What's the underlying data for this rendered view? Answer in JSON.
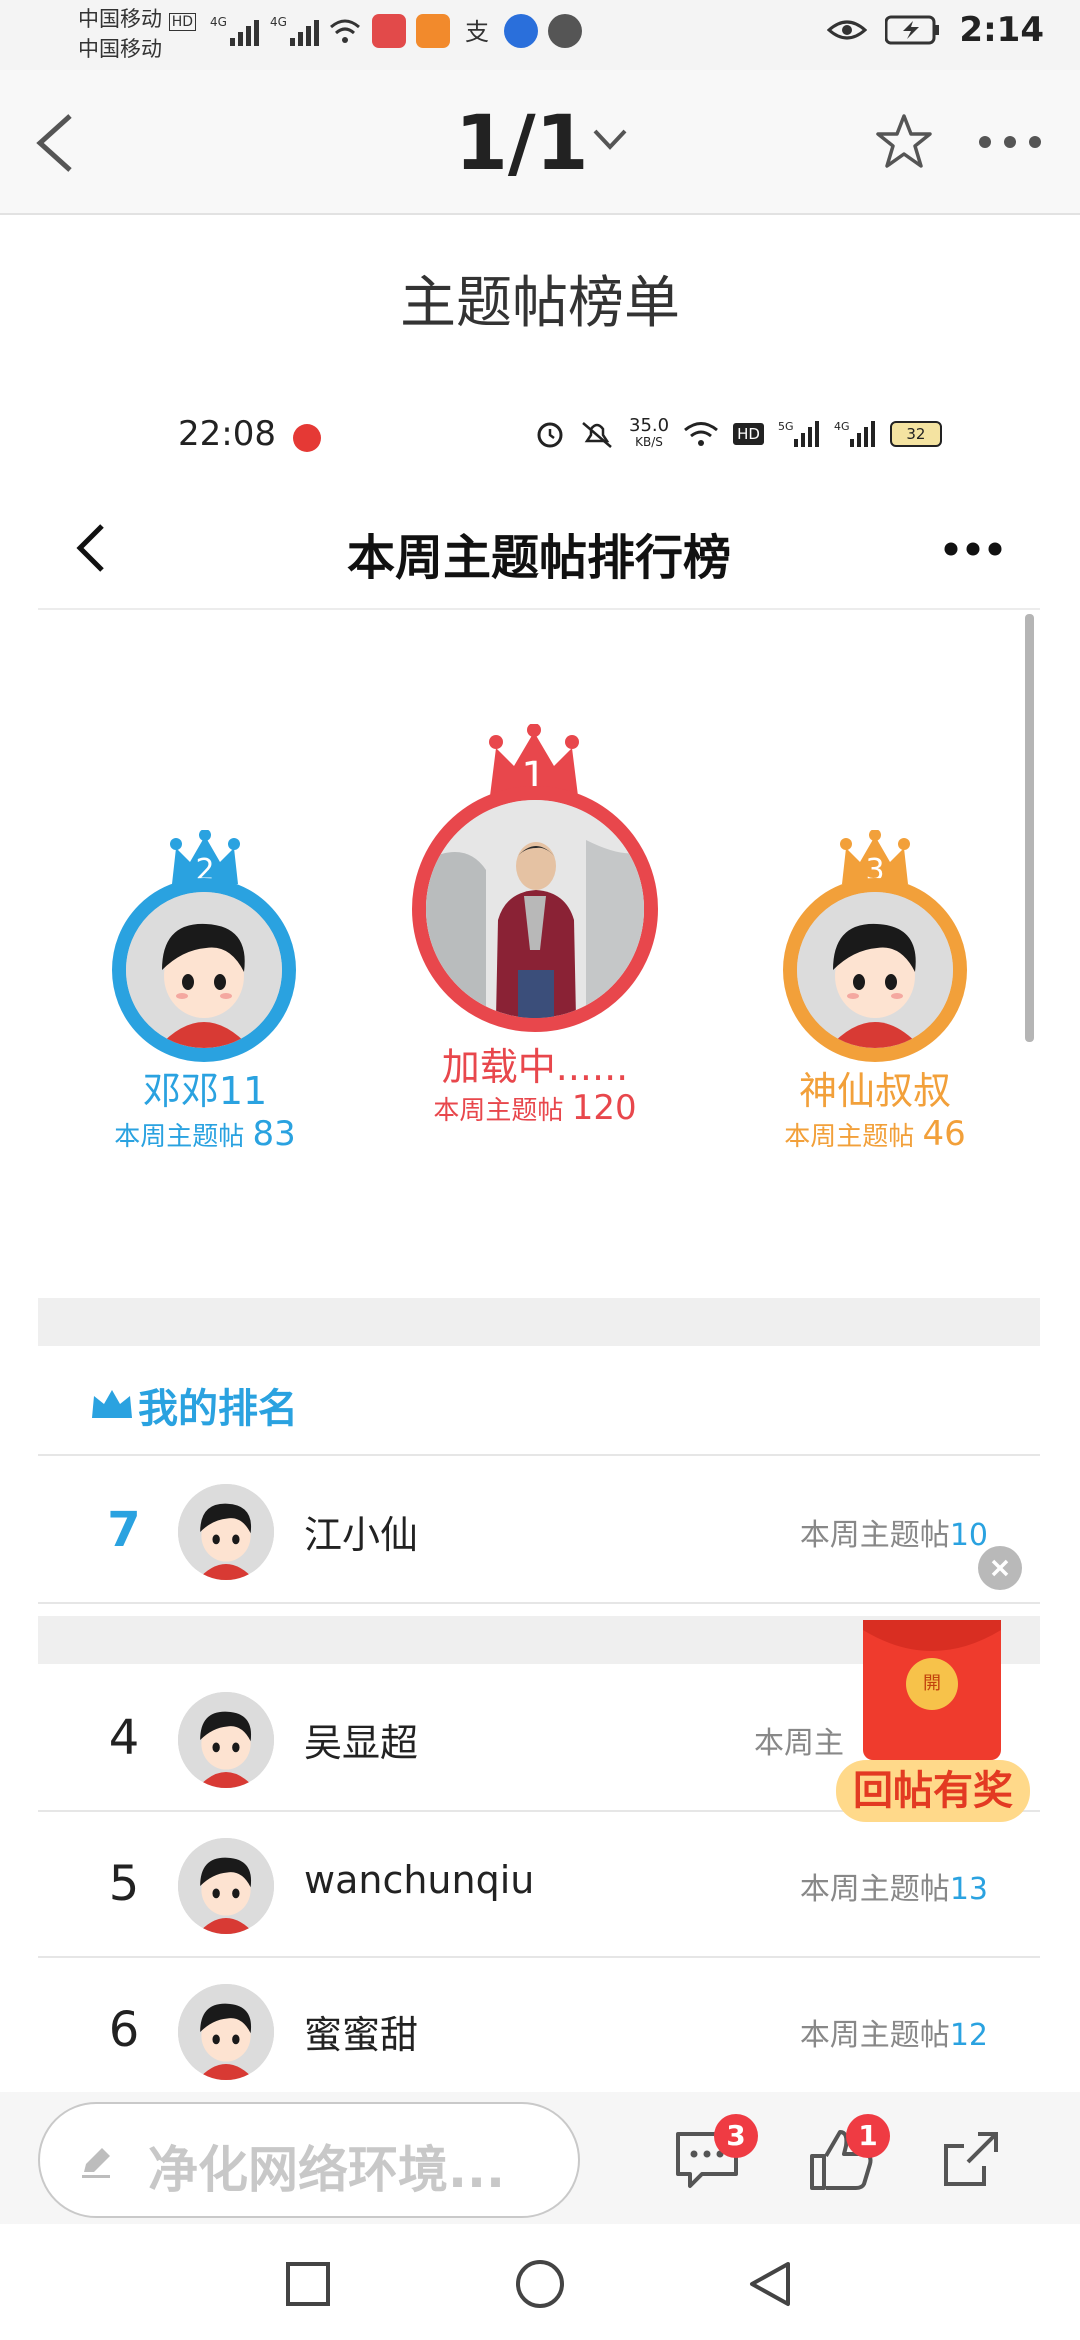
{
  "os_status": {
    "carrier_1": "中国移动",
    "carrier_2": "中国移动",
    "hd": "HD",
    "net_1": "4G",
    "net_2": "4G",
    "time": "2:14"
  },
  "outer_nav": {
    "page_indicator": "1/1"
  },
  "post": {
    "title": "主题帖榜单"
  },
  "inner_status": {
    "time": "22:08",
    "speed_value": "35.0",
    "speed_unit": "KB/S",
    "hd": "HD",
    "net_1": "5G",
    "net_2": "4G",
    "battery": "32"
  },
  "inner_header": {
    "title": "本周主题帖排行榜"
  },
  "podium": [
    {
      "rank": "2",
      "name": "邓邓11",
      "count_label": "本周主题帖",
      "count": "83",
      "color": "#2aa2e0"
    },
    {
      "rank": "1",
      "name": "加载中......",
      "count_label": "本周主题帖",
      "count": "120",
      "color": "#e8474c"
    },
    {
      "rank": "3",
      "name": "神仙叔叔",
      "count_label": "本周主题帖",
      "count": "46",
      "color": "#f2a03a"
    }
  ],
  "my_rank": {
    "label": "我的排名",
    "rank": "7",
    "name": "江小仙",
    "count_label": "本周主题帖",
    "count": "10"
  },
  "rankings": [
    {
      "rank": "4",
      "name": "吴显超",
      "count_label": "本周主",
      "count": ""
    },
    {
      "rank": "5",
      "name": "wanchunqiu",
      "count_label": "本周主题帖",
      "count": "13"
    },
    {
      "rank": "6",
      "name": "蜜蜜甜",
      "count_label": "本周主题帖",
      "count": "12"
    }
  ],
  "red_envelope": {
    "seal": "開",
    "banner": "回帖有奖"
  },
  "bottom_bar": {
    "placeholder": "净化网络环境...",
    "comment_badge": "3",
    "like_badge": "1"
  },
  "colors": {
    "accent_blue": "#2aa2e0",
    "first_red": "#e8474c",
    "third_orange": "#f2a03a",
    "badge_red": "#ef3b43"
  }
}
